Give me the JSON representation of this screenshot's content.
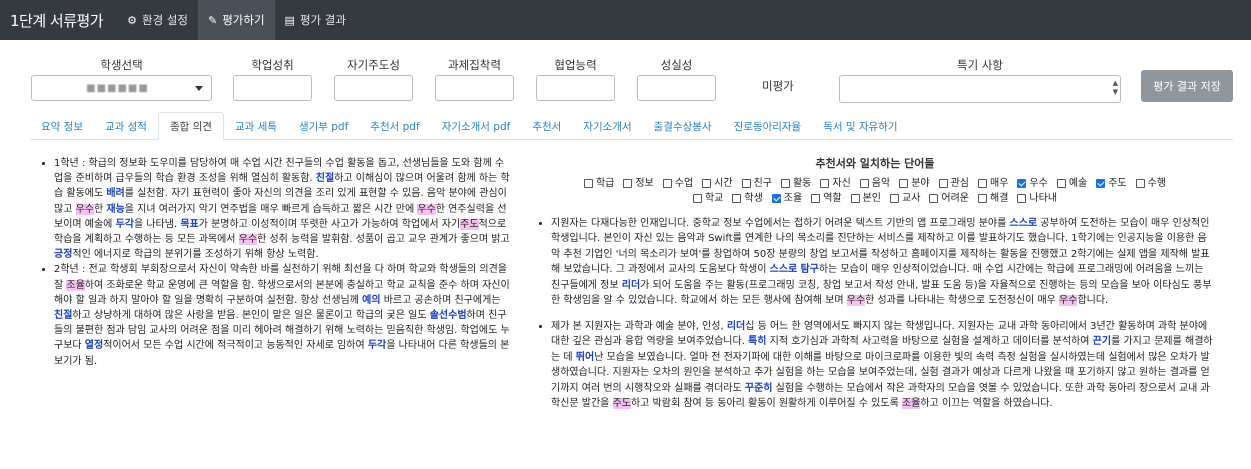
{
  "navbar": {
    "brand": "1단계 서류평가",
    "items": [
      {
        "label": "환경 설정",
        "icon": "gears-icon",
        "active": false
      },
      {
        "label": "평가하기",
        "icon": "edit-icon",
        "active": true
      },
      {
        "label": "평가 결과",
        "icon": "document-icon",
        "active": false
      }
    ]
  },
  "form": {
    "student_select_label": "학생선택",
    "student_select_value": "■■■■■■",
    "score_labels": [
      "학업성취",
      "자기주도성",
      "과제집착력",
      "협업능력",
      "성실성"
    ],
    "unrated_label": "미평가",
    "special_label": "특기 사항",
    "save_button": "평가 결과 저장"
  },
  "tabs": [
    "요약 정보",
    "교과 성적",
    "종합 의견",
    "교과 세특",
    "생기부 pdf",
    "추천서 pdf",
    "자기소개서 pdf",
    "추천서",
    "자기소개서",
    "출결수상봉사",
    "진로동아리자율",
    "독서 및 자유하기"
  ],
  "active_tab": "종합 의견",
  "left_paragraphs": [
    [
      {
        "t": "1학년 : 학급의 정보화 도우미를 담당하여 매 수업 시간 친구들의 수업 활동을 돕고, 선생님들을 도와 함께 수업을 준비하며 급우들의 학습 환경 조성을 위해 열심히 활동함. "
      },
      {
        "t": "친절",
        "c": "b"
      },
      {
        "t": "하고 이해심이 많으며 어울려 함께 하는 학습 활동에도 "
      },
      {
        "t": "배려",
        "c": "b"
      },
      {
        "t": "를 실천함. 자기 표현력이 좋아 자신의 의견을 조리 있게 표현할 수 있음. 음악 분야에 관심이 많고 "
      },
      {
        "t": "우수",
        "c": "p"
      },
      {
        "t": "한 "
      },
      {
        "t": "재능",
        "c": "b"
      },
      {
        "t": "을 지녀 여러가지 악기 연주법을 매우 빠르게 습득하고 짧은 시간 만에 "
      },
      {
        "t": "우수",
        "c": "p"
      },
      {
        "t": "한 연주실력을 선보이며 예술에 "
      },
      {
        "t": "두각",
        "c": "b"
      },
      {
        "t": "을 나타냄. "
      },
      {
        "t": "목표",
        "c": "b"
      },
      {
        "t": "가 분명하고 이성적이며 뚜렷한 사고가 가능하여 학업에서 자기"
      },
      {
        "t": "주도",
        "c": "p"
      },
      {
        "t": "적으로 학습을 계획하고 수행하는 등 모든 과목에서 "
      },
      {
        "t": "우수",
        "c": "p"
      },
      {
        "t": "한 성취 능력을 발휘함. 성품이 곱고 교우 관계가 좋으며 밝고 "
      },
      {
        "t": "긍정",
        "c": "b"
      },
      {
        "t": "적인 에너지로 학급의 분위기를 조성하기 위해 항상 노력함."
      }
    ],
    [
      {
        "t": "2학년 : 전교 학생회 부회장으로서 자신이 약속한 바를 실천하기 위해 최선을 다 하며 학교와 학생들의 의견을 잘 "
      },
      {
        "t": "조율",
        "c": "p"
      },
      {
        "t": "하여 조화로운 학교 운영에 큰 역할을 함. 학생으로서의 본분에 충실하고 학교 교칙을 준수 하며 자신이 해야 할 일과 하지 말아야 할 일을 명확히 구분하여 실천함. 항상 선생님께 "
      },
      {
        "t": "예의",
        "c": "b"
      },
      {
        "t": " 바르고 공손하며 친구에게는 "
      },
      {
        "t": "친절",
        "c": "b"
      },
      {
        "t": "하고 상냥하게 대하여 많은 사랑을 받음. 본인이 맡은 일은 물론이고 학급의 궂은 일도 "
      },
      {
        "t": "솔선수범",
        "c": "b"
      },
      {
        "t": "하며 친구들의 불편한 점과 담임 교사의 어려운 점을 미리 헤아려 해결하기 위해 노력하는 믿음직한 학생임. 학업에도 누구보다 "
      },
      {
        "t": "열정",
        "c": "b"
      },
      {
        "t": "적이어서 모든 수업 시간에 적극적이고 능동적인 자세로 임하여 "
      },
      {
        "t": "두각",
        "c": "b"
      },
      {
        "t": "을 나타내어 다른 학생들의 본보기가 됨."
      }
    ]
  ],
  "right_title": "추천서와 일치하는 단어들",
  "keywords_row1": [
    {
      "label": "학급",
      "checked": false
    },
    {
      "label": "정보",
      "checked": false
    },
    {
      "label": "수업",
      "checked": false
    },
    {
      "label": "시간",
      "checked": false
    },
    {
      "label": "친구",
      "checked": false
    },
    {
      "label": "활동",
      "checked": false
    },
    {
      "label": "자신",
      "checked": false
    },
    {
      "label": "음악",
      "checked": false
    },
    {
      "label": "분야",
      "checked": false
    },
    {
      "label": "관심",
      "checked": false
    },
    {
      "label": "매우",
      "checked": false
    },
    {
      "label": "우수",
      "checked": true
    },
    {
      "label": "예술",
      "checked": false
    },
    {
      "label": "주도",
      "checked": true
    },
    {
      "label": "수행",
      "checked": false
    }
  ],
  "keywords_row2": [
    {
      "label": "학교",
      "checked": false
    },
    {
      "label": "학생",
      "checked": false
    },
    {
      "label": "조율",
      "checked": true
    },
    {
      "label": "역할",
      "checked": false
    },
    {
      "label": "본인",
      "checked": false
    },
    {
      "label": "교사",
      "checked": false
    },
    {
      "label": "어려운",
      "checked": false
    },
    {
      "label": "해결",
      "checked": false
    },
    {
      "label": "나타내",
      "checked": false
    }
  ],
  "right_paragraphs": [
    [
      {
        "t": "지원자는 다재다능한 인재입니다. 중학교 정보 수업에서는 접하기 어려운 텍스트 기반의 앱 프로그래밍 분야를 "
      },
      {
        "t": "스스로",
        "c": "b"
      },
      {
        "t": " 공부하여 도전하는 모습이 매우 인상적인 학생입니다. 본인이 자신 있는 음악과 Swift를 연계한 나의 목소리를 진단하는 서비스를 제작하고 이를 발표하기도 했습니다. 1학기에는 인공지능을 이용한 음악 추천 기업인 '너의 목소리가 보여'를 창업하여 50장 분량의 창업 보고서를 작성하고 홈페이지를 제작하는 활동을 진행했고 2학기에는 실제 앱을 제작해 발표해 보았습니다. 그 과정에서 교사의 도움보다 학생이 "
      },
      {
        "t": "스스로",
        "c": "b"
      },
      {
        "t": " "
      },
      {
        "t": "탐구",
        "c": "b"
      },
      {
        "t": "하는 모습이 매우 인상적이었습니다. 매 수업 시간에는 학급에 프로그래밍에 어려움을 느끼는 친구들에게 정보 "
      },
      {
        "t": "리더",
        "c": "b"
      },
      {
        "t": "가 되어 도움을 주는 활동(프로그래밍 코칭, 창업 보고서 작성 안내, 발표 도움 등)을 자율적으로 진행하는 등의 모습을 보아 이타심도 풍부한 학생임을 알 수 있었습니다. 학교에서 하는 모든 행사에 참여해 보며 "
      },
      {
        "t": "우수",
        "c": "p"
      },
      {
        "t": "한 성과를 나타내는 학생으로 도전정신이 매우 "
      },
      {
        "t": "우수",
        "c": "p"
      },
      {
        "t": "합니다."
      }
    ],
    [
      {
        "t": "제가 본 지원자는 과학과 예술 분야, 인성, "
      },
      {
        "t": "리더",
        "c": "b"
      },
      {
        "t": "십 등 어느 한 영역에서도 빠지지 않는 학생입니다. 지원자는 교내 과학 동아리에서 3년간 활동하며 과학 분야에 대한 깊은 관심과 융합 역량을 보여주었습니다. "
      },
      {
        "t": "특히",
        "c": "b"
      },
      {
        "t": " 지적 호기심과 과학적 사고력을 바탕으로 실험을 설계하고 데이터를 분석하여 "
      },
      {
        "t": "끈기",
        "c": "b"
      },
      {
        "t": "를 가지고 문제를 해결하는 데 "
      },
      {
        "t": "뛰어",
        "c": "b"
      },
      {
        "t": "난 모습을 보였습니다. 얼마 전 전자기파에 대한 이해를 바탕으로 마이크로파를 이용한 빛의 속력 측정 실험을 실시하였는데 실험에서 많은 오차가 발생하였습니다. 지원자는 오차의 원인을 분석하고 추가 실험을 하는 모습을 보여주었는데, 실험 결과가 예상과 다르게 나왔을 때 포기하지 않고 원하는 결과를 얻기까지 여러 번의 시행착오와 실패를 겪더라도 "
      },
      {
        "t": "꾸준히",
        "c": "b"
      },
      {
        "t": " 실험을 수행하는 모습에서 작은 과학자의 모습을 엿볼 수 있었습니다. 또한 과학 동아리 장으로서 교내 과학신문 발간을 "
      },
      {
        "t": "주도",
        "c": "p"
      },
      {
        "t": "하고 박람회 참여 등 동아리 활동이 원활하게 이루어질 수 있도록 "
      },
      {
        "t": "조율",
        "c": "p"
      },
      {
        "t": "하고 이끄는 역할을 하였습니다."
      }
    ]
  ],
  "colors": {
    "navbar": "#343a40",
    "tab_link": "#2a83c8",
    "keyword_blue": "#1a3fb8",
    "highlight_pink": "#f4c1f0",
    "save_button": "#8f969c"
  }
}
